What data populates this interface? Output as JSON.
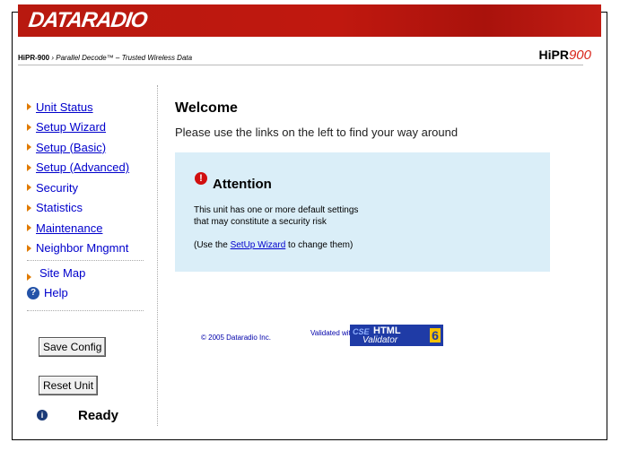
{
  "brand": {
    "logo": "DATARADIO"
  },
  "subtitle": {
    "model": "HiPR-900",
    "sep": " › ",
    "text": "Parallel Decode™ – Trusted Wireless Data"
  },
  "product": {
    "prefix": "HiPR",
    "suffix": "900"
  },
  "nav": {
    "items": [
      {
        "label": "Unit Status",
        "link": true
      },
      {
        "label": "Setup Wizard",
        "link": true
      },
      {
        "label": "Setup (Basic)",
        "link": true
      },
      {
        "label": "Setup (Advanced)",
        "link": true
      },
      {
        "label": "Security",
        "link": false
      },
      {
        "label": "Statistics",
        "link": false
      },
      {
        "label": "Maintenance",
        "link": true
      },
      {
        "label": "Neighbor Mngmnt",
        "link": false
      }
    ],
    "site_map": "Site Map",
    "help": "Help"
  },
  "buttons": {
    "save": "Save Config",
    "reset": "Reset Unit"
  },
  "status": {
    "text": "Ready"
  },
  "main": {
    "title": "Welcome",
    "intro": "Please use the links on the left to find your way around",
    "attention": {
      "title": "Attention",
      "line1": "This unit has one or more default settings",
      "line2": "that may constitute a security risk",
      "line3_pre": "(Use the ",
      "line3_link": "SetUp Wizard",
      "line3_post": " to change them)"
    }
  },
  "footer": {
    "copyright": "© 2005 Dataradio Inc.",
    "validated": "Validated with:"
  },
  "badge": {
    "cse": "CSE",
    "html": "HTML",
    "validator": "Validator",
    "version": "6"
  },
  "colors": {
    "banner": "#c0180f",
    "link": "#0000cc",
    "attention_bg": "#daeef8"
  }
}
